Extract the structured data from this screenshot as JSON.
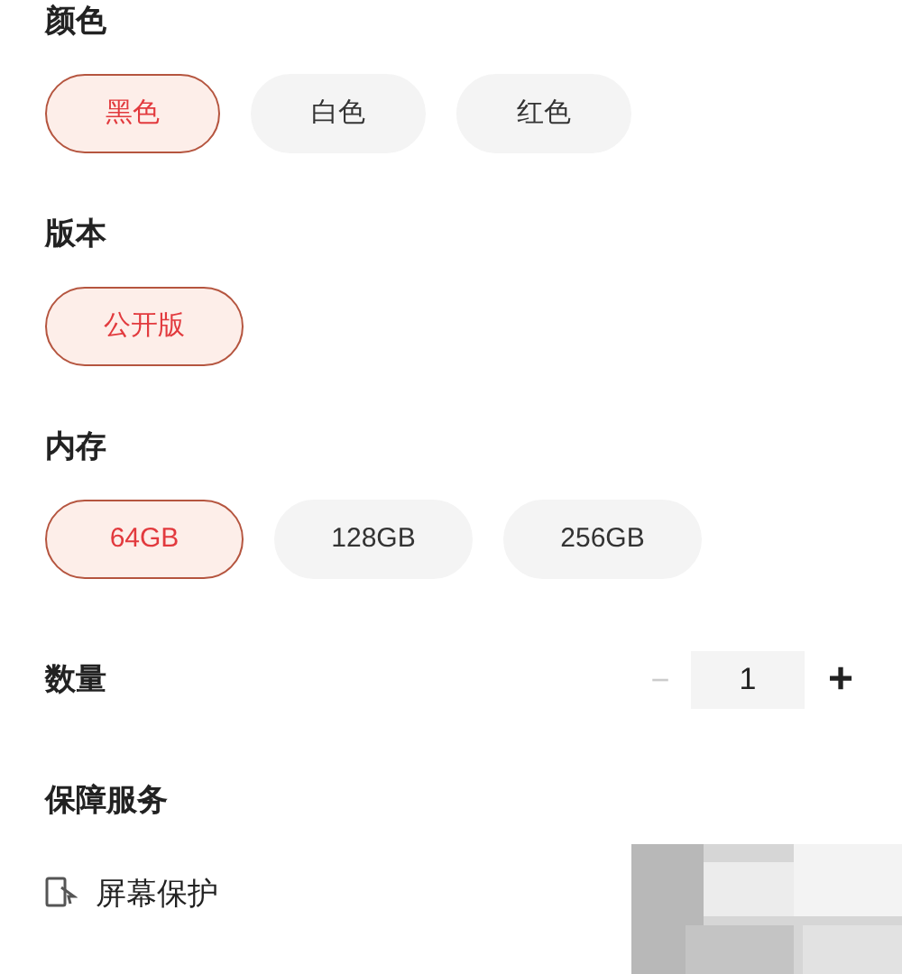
{
  "sections": [
    {
      "title": "颜色",
      "options": [
        {
          "label": "黑色",
          "selected": true
        },
        {
          "label": "白色",
          "selected": false
        },
        {
          "label": "红色",
          "selected": false
        }
      ]
    },
    {
      "title": "版本",
      "options": [
        {
          "label": "公开版",
          "selected": true
        }
      ]
    },
    {
      "title": "内存",
      "options": [
        {
          "label": "64GB",
          "selected": true
        },
        {
          "label": "128GB",
          "selected": false
        },
        {
          "label": "256GB",
          "selected": false
        }
      ]
    }
  ],
  "quantity": {
    "label": "数量",
    "minus": "−",
    "value": "1",
    "plus": "+",
    "minus_disabled": true
  },
  "services": {
    "title": "保障服务",
    "items": [
      {
        "label": "屏幕保护"
      }
    ]
  }
}
